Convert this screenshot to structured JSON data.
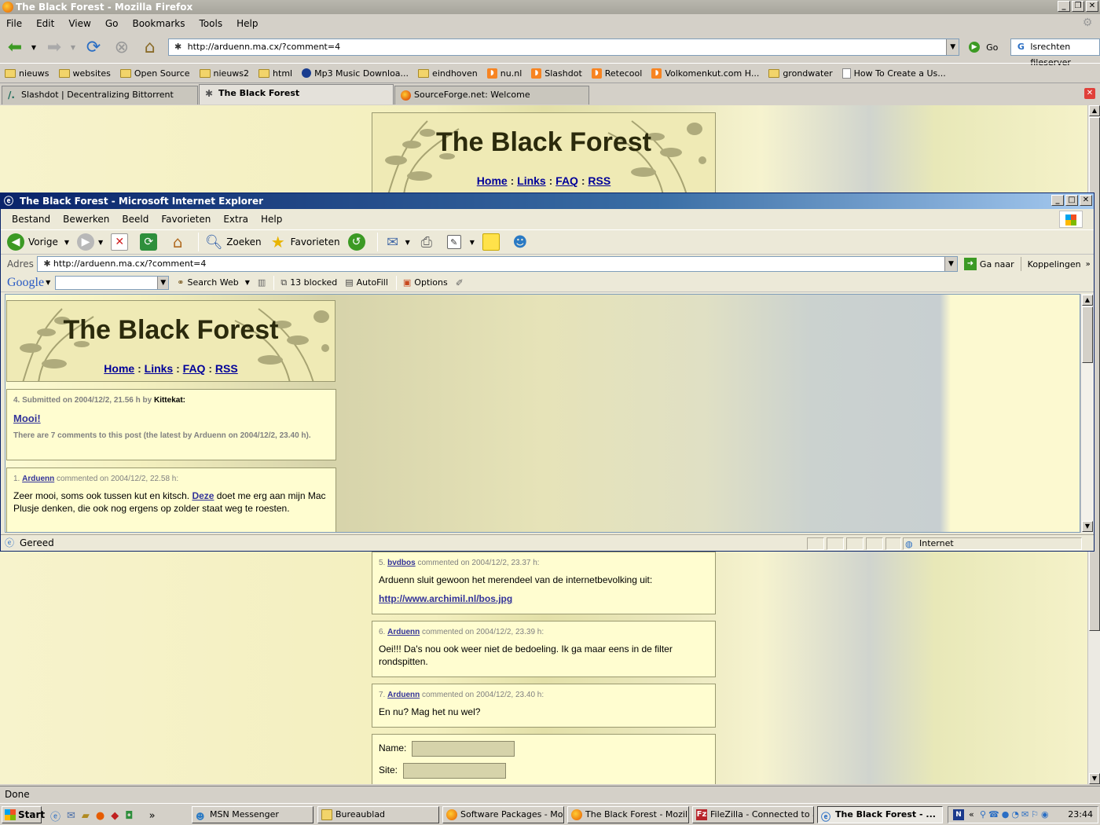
{
  "firefox": {
    "title": "The Black Forest - Mozilla Firefox",
    "menu": [
      "File",
      "Edit",
      "View",
      "Go",
      "Bookmarks",
      "Tools",
      "Help"
    ],
    "url": "http://arduenn.ma.cx/?comment=4",
    "go_label": "Go",
    "search_value": "lsrechten fileserver",
    "bookmarks": [
      {
        "label": "nieuws",
        "icon": "folder-icon"
      },
      {
        "label": "websites",
        "icon": "folder-icon"
      },
      {
        "label": "Open Source",
        "icon": "folder-icon"
      },
      {
        "label": "nieuws2",
        "icon": "folder-icon"
      },
      {
        "label": "html",
        "icon": "folder-icon"
      },
      {
        "label": "Mp3 Music Downloa...",
        "icon": "mp3-icon"
      },
      {
        "label": "eindhoven",
        "icon": "folder-icon"
      },
      {
        "label": "nu.nl",
        "icon": "rss-icon"
      },
      {
        "label": "Slashdot",
        "icon": "rss-icon"
      },
      {
        "label": "Retecool",
        "icon": "rss-icon"
      },
      {
        "label": "Volkomenkut.com H...",
        "icon": "rss-icon"
      },
      {
        "label": "grondwater",
        "icon": "folder-icon"
      },
      {
        "label": "How To Create a Us...",
        "icon": "page-icon"
      }
    ],
    "tabs": [
      {
        "label": "Slashdot | Decentralizing Bittorrent"
      },
      {
        "label": "The Black Forest"
      },
      {
        "label": "SourceForge.net: Welcome"
      }
    ],
    "status": "Done"
  },
  "site": {
    "title": "The Black Forest",
    "nav": [
      "Home",
      "Links",
      "FAQ",
      "RSS"
    ],
    "nav_sep": ":"
  },
  "ff_comments": [
    {
      "num": "5.",
      "author": "bvdbos",
      "meta": "commented on 2004/12/2, 23.37 h:",
      "text": "Arduenn sluit gewoon het merendeel van de internetbevolking uit:",
      "link": "http://www.archimil.nl/bos.jpg"
    },
    {
      "num": "6.",
      "author": "Arduenn",
      "meta": "commented on 2004/12/2, 23.39 h:",
      "text": "Oei!!! Da's nou ook weer niet de bedoeling. Ik ga maar eens in de filter rondspitten."
    },
    {
      "num": "7.",
      "author": "Arduenn",
      "meta": "commented on 2004/12/2, 23.40 h:",
      "text": "En nu? Mag het nu wel?"
    }
  ],
  "form": {
    "name_label": "Name:",
    "site_label": "Site:"
  },
  "ie": {
    "title": "The Black Forest - Microsoft Internet Explorer",
    "menu": [
      "Bestand",
      "Bewerken",
      "Beeld",
      "Favorieten",
      "Extra",
      "Help"
    ],
    "back_label": "Vorige",
    "search_label": "Zoeken",
    "favorites_label": "Favorieten",
    "address_label": "Adres",
    "url": "http://arduenn.ma.cx/?comment=4",
    "go_label": "Ga naar",
    "links_label": "Koppelingen",
    "google": {
      "logo": "Google",
      "search_web": "Search Web",
      "blocked": "13 blocked",
      "autofill": "AutoFill",
      "options": "Options"
    },
    "status": "Gereed",
    "zone": "Internet"
  },
  "post": {
    "meta": "4. Submitted on 2004/12/2, 21.56 h by",
    "author": "Kittekat",
    "author_suffix": ":",
    "title": "Mooi!",
    "summary": "There are 7 comments to this post (the latest by Arduenn on 2004/12/2, 23.40 h)."
  },
  "ie_comment": {
    "num": "1.",
    "author": "Arduenn",
    "meta": "commented on 2004/12/2, 22.58 h:",
    "text_before": "Zeer mooi, soms ook tussen kut en kitsch.",
    "link": "Deze",
    "text_after": "doet me erg aan mijn Mac Plusje denken, die ook nog ergens op zolder staat weg te roesten."
  },
  "taskbar": {
    "start": "Start",
    "tasks": [
      "MSN Messenger",
      "Bureaublad",
      "Software Packages - Mo...",
      "The Black Forest - Mozill...",
      "FileZilla - Connected to a...",
      "The Black Forest - ..."
    ],
    "clock": "23:44",
    "more": "»"
  },
  "colors": {
    "link": "#000099",
    "title_text": "#2b2a0c",
    "comment_bg": "#fffdd0",
    "ie_title": "#0a246a"
  }
}
